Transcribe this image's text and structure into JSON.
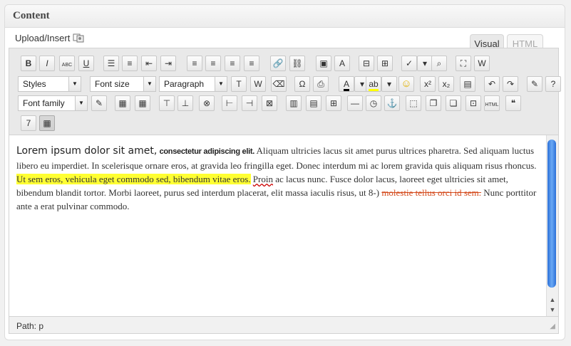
{
  "panel": {
    "title": "Content"
  },
  "media": {
    "label": "Upload/Insert",
    "icon": "media-insert-icons"
  },
  "tabs": [
    {
      "label": "Visual",
      "active": true
    },
    {
      "label": "HTML",
      "active": false
    }
  ],
  "toolbar": {
    "row1": [
      {
        "name": "bold-button",
        "glyph": "B"
      },
      {
        "name": "italic-button",
        "glyph": "I"
      },
      {
        "name": "strikethrough-button",
        "glyph": "ABC"
      },
      {
        "name": "underline-button",
        "glyph": "U"
      },
      {
        "name": "bullet-list-button",
        "glyph": "☰"
      },
      {
        "name": "numbered-list-button",
        "glyph": "≡"
      },
      {
        "name": "outdent-button",
        "glyph": "⇤"
      },
      {
        "name": "indent-button",
        "glyph": "⇥"
      },
      {
        "name": "align-left-button",
        "glyph": "≡"
      },
      {
        "name": "align-center-button",
        "glyph": "≡"
      },
      {
        "name": "align-justify-button",
        "glyph": "≡"
      },
      {
        "name": "align-right-button",
        "glyph": "≡"
      },
      {
        "name": "insert-link-button",
        "glyph": "🔗"
      },
      {
        "name": "unlink-button",
        "glyph": "⛓"
      },
      {
        "name": "insert-image-button",
        "glyph": "▣"
      },
      {
        "name": "insert-font-button",
        "glyph": "A"
      },
      {
        "name": "insert-more-button",
        "glyph": "⊟"
      },
      {
        "name": "page-break-button",
        "glyph": "⊞"
      },
      {
        "name": "spellcheck-button",
        "glyph": "✓"
      },
      {
        "name": "spellcheck-dropdown-button",
        "glyph": "▾"
      },
      {
        "name": "find-button",
        "glyph": "⌕"
      },
      {
        "name": "fullscreen-button",
        "glyph": "⛶"
      },
      {
        "name": "paste-word-button",
        "glyph": "W"
      }
    ],
    "row2": {
      "styles": "Styles",
      "font_size": "Font size",
      "format": "Paragraph",
      "buttons": [
        {
          "name": "paste-text-button",
          "glyph": "T"
        },
        {
          "name": "paste-from-word-button",
          "glyph": "W"
        },
        {
          "name": "remove-format-button",
          "glyph": "⌫"
        },
        {
          "name": "special-char-button",
          "glyph": "Ω"
        },
        {
          "name": "print-button",
          "glyph": "⎙"
        },
        {
          "name": "text-color-button",
          "glyph": "A"
        },
        {
          "name": "text-color-dropdown",
          "glyph": "▾"
        },
        {
          "name": "highlight-color-button",
          "glyph": "ab"
        },
        {
          "name": "highlight-color-dropdown",
          "glyph": "▾"
        },
        {
          "name": "emoticon-button",
          "glyph": "☺"
        },
        {
          "name": "superscript-button",
          "glyph": "x²"
        },
        {
          "name": "subscript-button",
          "glyph": "x₂"
        },
        {
          "name": "insert-media-button",
          "glyph": "▤"
        },
        {
          "name": "undo-button",
          "glyph": "↶"
        },
        {
          "name": "redo-button",
          "glyph": "↷"
        },
        {
          "name": "edit-html-button",
          "glyph": "✎"
        },
        {
          "name": "help-button",
          "glyph": "?"
        }
      ]
    },
    "row3": {
      "font_family": "Font family",
      "buttons": [
        {
          "name": "edit-css-button",
          "glyph": "✎"
        },
        {
          "name": "table-row-props-button",
          "glyph": "▦"
        },
        {
          "name": "table-cell-props-button",
          "glyph": "▦"
        },
        {
          "name": "insert-row-before-button",
          "glyph": "⊤"
        },
        {
          "name": "insert-row-after-button",
          "glyph": "⊥"
        },
        {
          "name": "delete-row-button",
          "glyph": "⊗"
        },
        {
          "name": "insert-col-before-button",
          "glyph": "⊢"
        },
        {
          "name": "insert-col-after-button",
          "glyph": "⊣"
        },
        {
          "name": "delete-col-button",
          "glyph": "⊠"
        },
        {
          "name": "split-cells-button",
          "glyph": "▥"
        },
        {
          "name": "merge-cells-button",
          "glyph": "▤"
        },
        {
          "name": "delete-table-button",
          "glyph": "⊞"
        },
        {
          "name": "horizontal-rule-button",
          "glyph": "—"
        },
        {
          "name": "insert-date-time-button",
          "glyph": "◷"
        },
        {
          "name": "anchor-button",
          "glyph": "⚓"
        },
        {
          "name": "visual-aid-button",
          "glyph": "⬚"
        },
        {
          "name": "layer-forward-button",
          "glyph": "❐"
        },
        {
          "name": "layer-backward-button",
          "glyph": "❏"
        },
        {
          "name": "insert-layer-button",
          "glyph": "⊡"
        },
        {
          "name": "html-source-button",
          "glyph": "HTML"
        },
        {
          "name": "blockquote-button",
          "glyph": "❝"
        }
      ]
    },
    "row4": [
      {
        "name": "insert-date-button",
        "glyph": "7"
      },
      {
        "name": "insert-table-button",
        "glyph": "▦"
      }
    ]
  },
  "editor": {
    "lorem": "Lorem ipsum dolor sit amet,",
    "consectetur": "consectetur adipiscing elit.",
    "text1": "Aliquam ultricies lacus sit amet purus ultrices pharetra. Sed aliquam luctus libero eu imperdiet. In scelerisque ornare eros, at gravida leo fringilla eget. Donec interdum mi ac lorem gravida quis aliquam risus rhoncus.",
    "highlighted": "Ut sem eros, vehicula eget commodo sed, bibendum vitae eros.",
    "proin": "Proin",
    "text2": "ac lacus nunc. Fusce dolor lacus, laoreet eget ultricies sit amet, bibendum blandit tortor. Morbi laoreet, purus sed interdum placerat, elit massa iaculis risus, ut 8-)",
    "strikethrough": "molestie tellus orci id sem.",
    "text3": "Nunc porttitor ante a erat pulvinar commodo."
  },
  "statusbar": {
    "path": "Path: p"
  }
}
